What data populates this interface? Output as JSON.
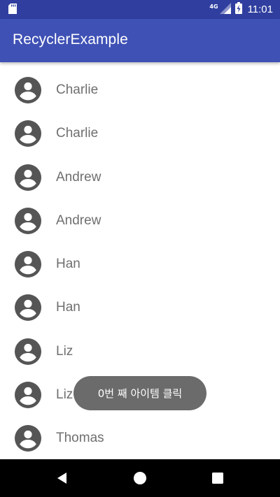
{
  "status_bar": {
    "network_label": "4G",
    "time": "11:01",
    "icons": [
      "sd-card-icon",
      "signal-icon",
      "battery-charging-icon"
    ]
  },
  "app_bar": {
    "title": "RecyclerExample"
  },
  "list": {
    "items": [
      {
        "name": "Charlie",
        "icon": "account-circle-icon"
      },
      {
        "name": "Charlie",
        "icon": "account-circle-icon"
      },
      {
        "name": "Andrew",
        "icon": "account-circle-icon"
      },
      {
        "name": "Andrew",
        "icon": "account-circle-icon"
      },
      {
        "name": "Han",
        "icon": "account-circle-icon"
      },
      {
        "name": "Han",
        "icon": "account-circle-icon"
      },
      {
        "name": "Liz",
        "icon": "account-circle-icon"
      },
      {
        "name": "Liz",
        "icon": "account-circle-icon"
      },
      {
        "name": "Thomas",
        "icon": "account-circle-icon"
      }
    ]
  },
  "toast": {
    "message": "0번 째 아이템 클릭"
  },
  "nav_bar": {
    "icons": [
      "back-icon",
      "home-icon",
      "recents-icon"
    ]
  },
  "colors": {
    "status_bar": "#303f9f",
    "app_bar": "#3f51b5",
    "avatar": "#555555",
    "item_text": "#6f6f6f",
    "toast_bg": "#6b6b6b",
    "nav_bar": "#000000"
  }
}
